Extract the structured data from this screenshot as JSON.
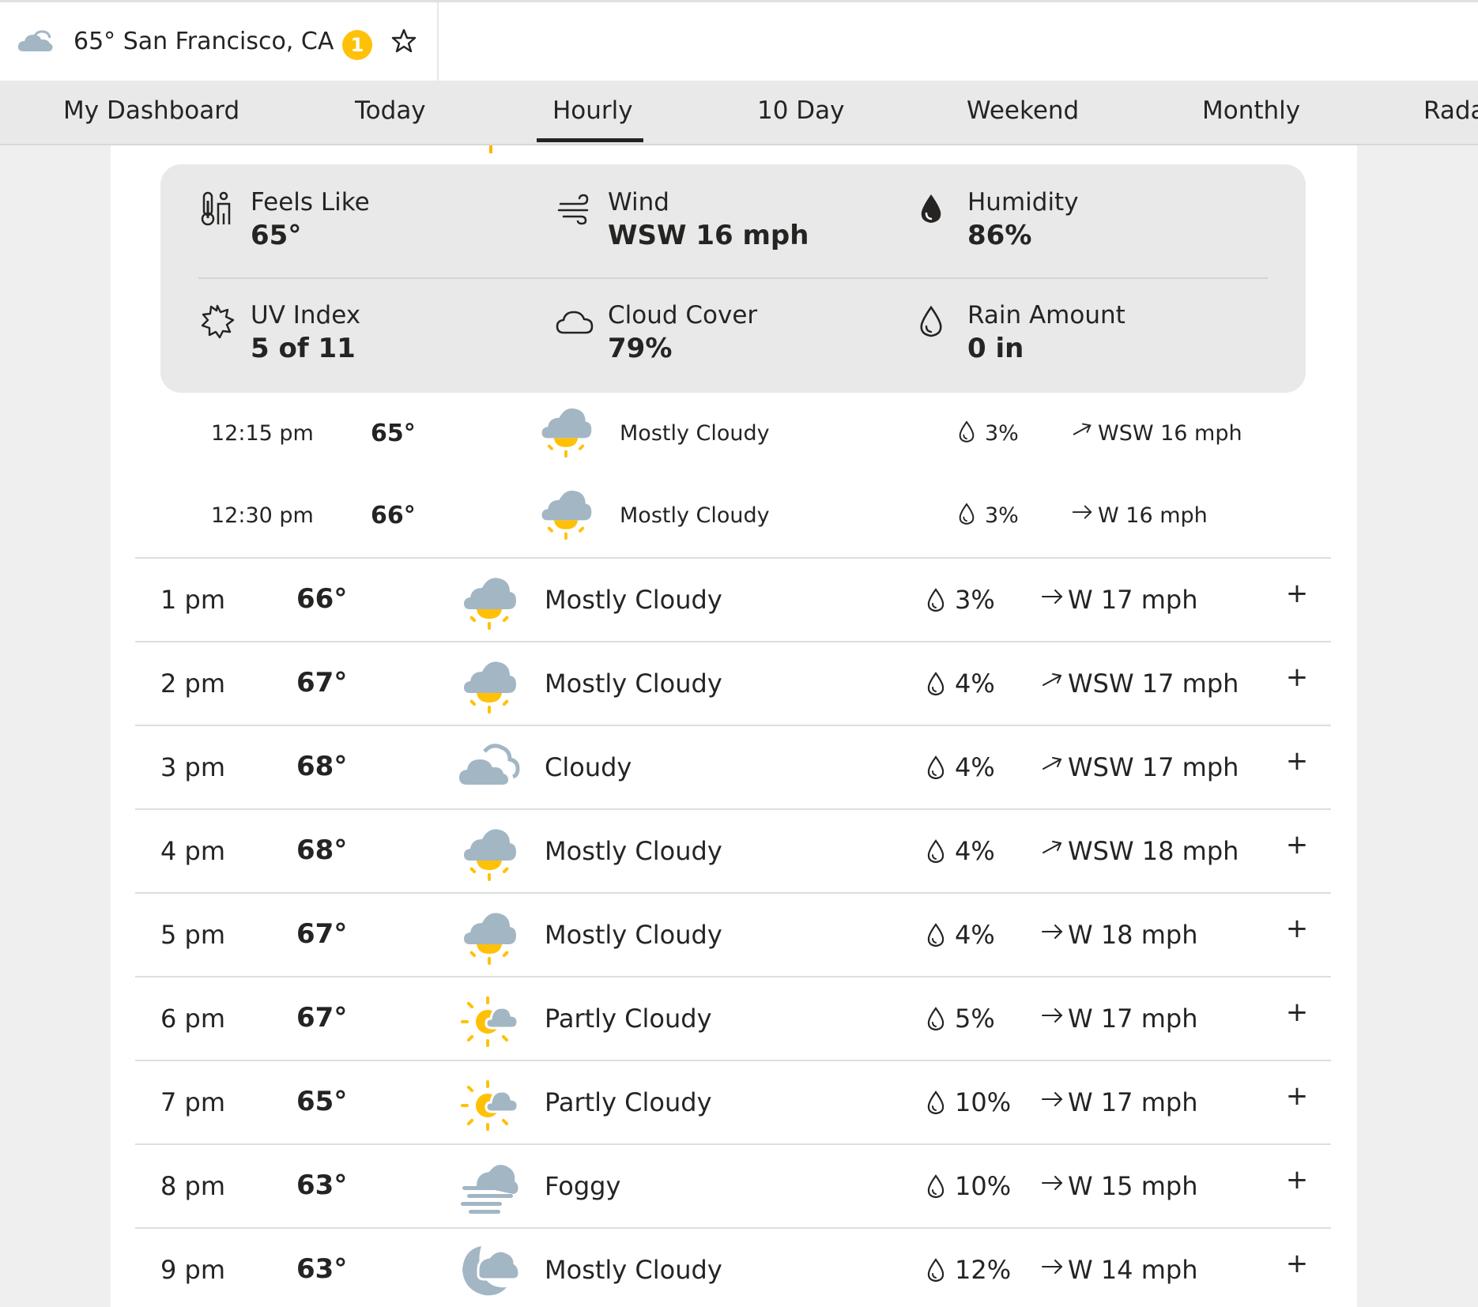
{
  "location_bar": {
    "title": "65° San Francisco, CA",
    "badge": "1",
    "icons": [
      "cloudy-icon",
      "star-icon"
    ]
  },
  "nav": {
    "items": [
      "My Dashboard",
      "Today",
      "Hourly",
      "10 Day",
      "Weekend",
      "Monthly",
      "Rada"
    ],
    "active": "Hourly"
  },
  "details": {
    "feels_like": {
      "label": "Feels Like",
      "value": "65°",
      "icon": "thermometer-person-icon"
    },
    "wind": {
      "label": "Wind",
      "value": "WSW 16 mph",
      "icon": "wind-icon"
    },
    "humidity": {
      "label": "Humidity",
      "value": "86%",
      "icon": "humidity-drop-icon"
    },
    "uv_index": {
      "label": "UV Index",
      "value": "5 of 11",
      "icon": "uv-sun-icon"
    },
    "cloud_cover": {
      "label": "Cloud Cover",
      "value": "79%",
      "icon": "cloud-outline-icon"
    },
    "rain_amount": {
      "label": "Rain Amount",
      "value": "0 in",
      "icon": "raindrop-outline-icon"
    }
  },
  "quarter_rows": [
    {
      "time": "12:15 pm",
      "temp": "65°",
      "condition": "Mostly Cloudy",
      "precip": "3%",
      "wind": "WSW 16 mph",
      "icon": "mostly-cloudy-day-icon",
      "wind_dir": "WSW"
    },
    {
      "time": "12:30 pm",
      "temp": "66°",
      "condition": "Mostly Cloudy",
      "precip": "3%",
      "wind": "W 16 mph",
      "icon": "mostly-cloudy-day-icon",
      "wind_dir": "W"
    }
  ],
  "hourly_rows": [
    {
      "time": "1 pm",
      "temp": "66°",
      "condition": "Mostly Cloudy",
      "precip": "3%",
      "wind": "W 17 mph",
      "icon": "mostly-cloudy-day-icon",
      "wind_dir": "W"
    },
    {
      "time": "2 pm",
      "temp": "67°",
      "condition": "Mostly Cloudy",
      "precip": "4%",
      "wind": "WSW 17 mph",
      "icon": "mostly-cloudy-day-icon",
      "wind_dir": "WSW"
    },
    {
      "time": "3 pm",
      "temp": "68°",
      "condition": "Cloudy",
      "precip": "4%",
      "wind": "WSW 17 mph",
      "icon": "cloudy-icon",
      "wind_dir": "WSW"
    },
    {
      "time": "4 pm",
      "temp": "68°",
      "condition": "Mostly Cloudy",
      "precip": "4%",
      "wind": "WSW 18 mph",
      "icon": "mostly-cloudy-day-icon",
      "wind_dir": "WSW"
    },
    {
      "time": "5 pm",
      "temp": "67°",
      "condition": "Mostly Cloudy",
      "precip": "4%",
      "wind": "W 18 mph",
      "icon": "mostly-cloudy-day-icon",
      "wind_dir": "W"
    },
    {
      "time": "6 pm",
      "temp": "67°",
      "condition": "Partly Cloudy",
      "precip": "5%",
      "wind": "W 17 mph",
      "icon": "partly-cloudy-day-icon",
      "wind_dir": "W"
    },
    {
      "time": "7 pm",
      "temp": "65°",
      "condition": "Partly Cloudy",
      "precip": "10%",
      "wind": "W 17 mph",
      "icon": "partly-cloudy-day-icon",
      "wind_dir": "W"
    },
    {
      "time": "8 pm",
      "temp": "63°",
      "condition": "Foggy",
      "precip": "10%",
      "wind": "W 15 mph",
      "icon": "foggy-icon",
      "wind_dir": "W"
    },
    {
      "time": "9 pm",
      "temp": "63°",
      "condition": "Mostly Cloudy",
      "precip": "12%",
      "wind": "W 14 mph",
      "icon": "mostly-cloudy-night-icon",
      "wind_dir": "W"
    }
  ],
  "expand_label": "+",
  "colors": {
    "cloud": "#a3b6c4",
    "sun": "#ffc107",
    "text": "#252422",
    "badge": "#ffc107"
  }
}
